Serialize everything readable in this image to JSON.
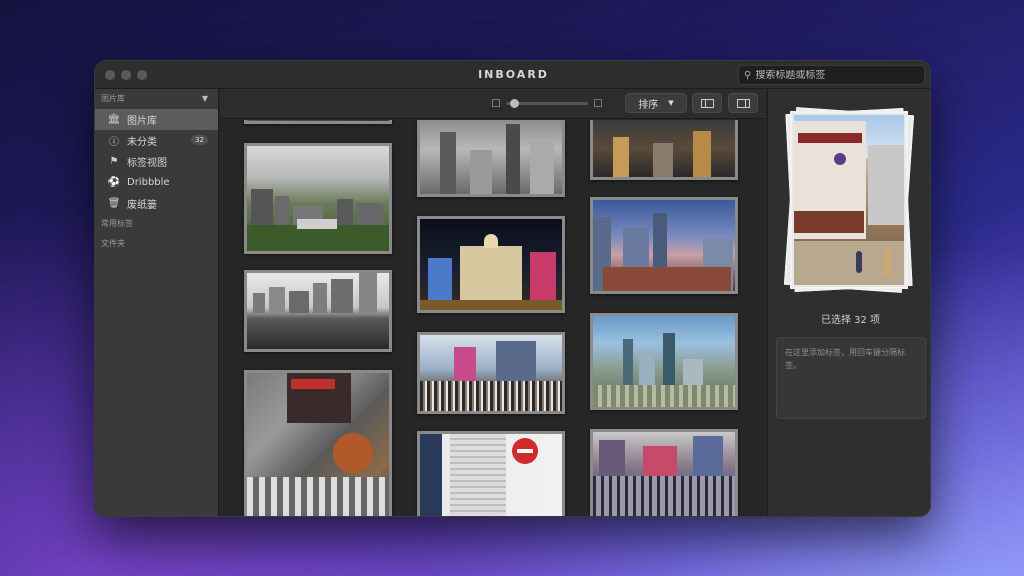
{
  "app": {
    "title": "INBOARD"
  },
  "search": {
    "placeholder": "搜索标题或标签"
  },
  "sidebar": {
    "library_header": "图片库",
    "items": [
      {
        "label": "图片库",
        "icon": "library-icon",
        "active": true
      },
      {
        "label": "未分类",
        "icon": "question-icon",
        "badge": "32"
      },
      {
        "label": "标签视图",
        "icon": "tag-icon"
      },
      {
        "label": "Dribbble",
        "icon": "dribbble-icon"
      },
      {
        "label": "废纸篓",
        "icon": "trash-icon"
      }
    ],
    "common_tags_header": "常用标签",
    "folders_header": "文件夹"
  },
  "toolbar": {
    "sort_label": "排序",
    "thumbnail_size": 0.05
  },
  "inspector": {
    "selected_label": "已选择 32 项",
    "tag_placeholder": "在这里添加标签，用回车键分隔标签。"
  },
  "colors": {
    "accent_active": "#5c5c5c",
    "window_bg": "#282828"
  }
}
